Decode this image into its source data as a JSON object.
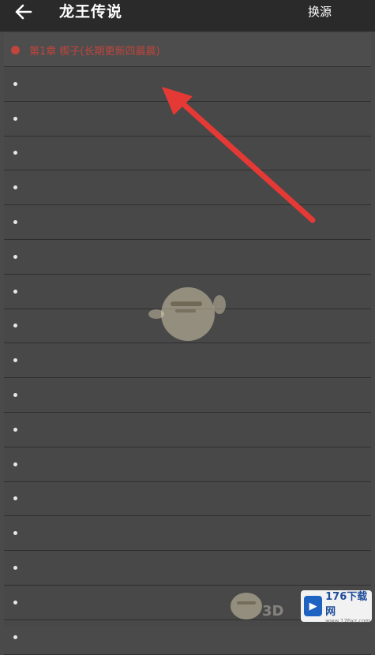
{
  "header": {
    "back_icon": "back-arrow-icon",
    "title": "龙王传说",
    "source_label": "换源"
  },
  "chapters": [
    {
      "label": "第1章 楔子(长期更新四晨晨)",
      "current": true
    },
    {
      "label": "",
      "current": false
    },
    {
      "label": "",
      "current": false
    },
    {
      "label": "",
      "current": false
    },
    {
      "label": "",
      "current": false
    },
    {
      "label": "",
      "current": false
    },
    {
      "label": "",
      "current": false
    },
    {
      "label": "",
      "current": false
    },
    {
      "label": "",
      "current": false
    },
    {
      "label": "",
      "current": false
    },
    {
      "label": "",
      "current": false
    },
    {
      "label": "",
      "current": false
    },
    {
      "label": "",
      "current": false
    },
    {
      "label": "",
      "current": false
    },
    {
      "label": "",
      "current": false
    },
    {
      "label": "",
      "current": false
    },
    {
      "label": "",
      "current": false
    },
    {
      "label": "",
      "current": false
    }
  ],
  "watermark": {
    "logo_number": "176",
    "logo_name": "下载网",
    "logo_url": "www.176xz.com",
    "corner_text": "3D"
  },
  "colors": {
    "accent": "#c0453c",
    "arrow": "#e53935",
    "list_bg": "#484848",
    "header_bg": "#2a2a2a"
  }
}
